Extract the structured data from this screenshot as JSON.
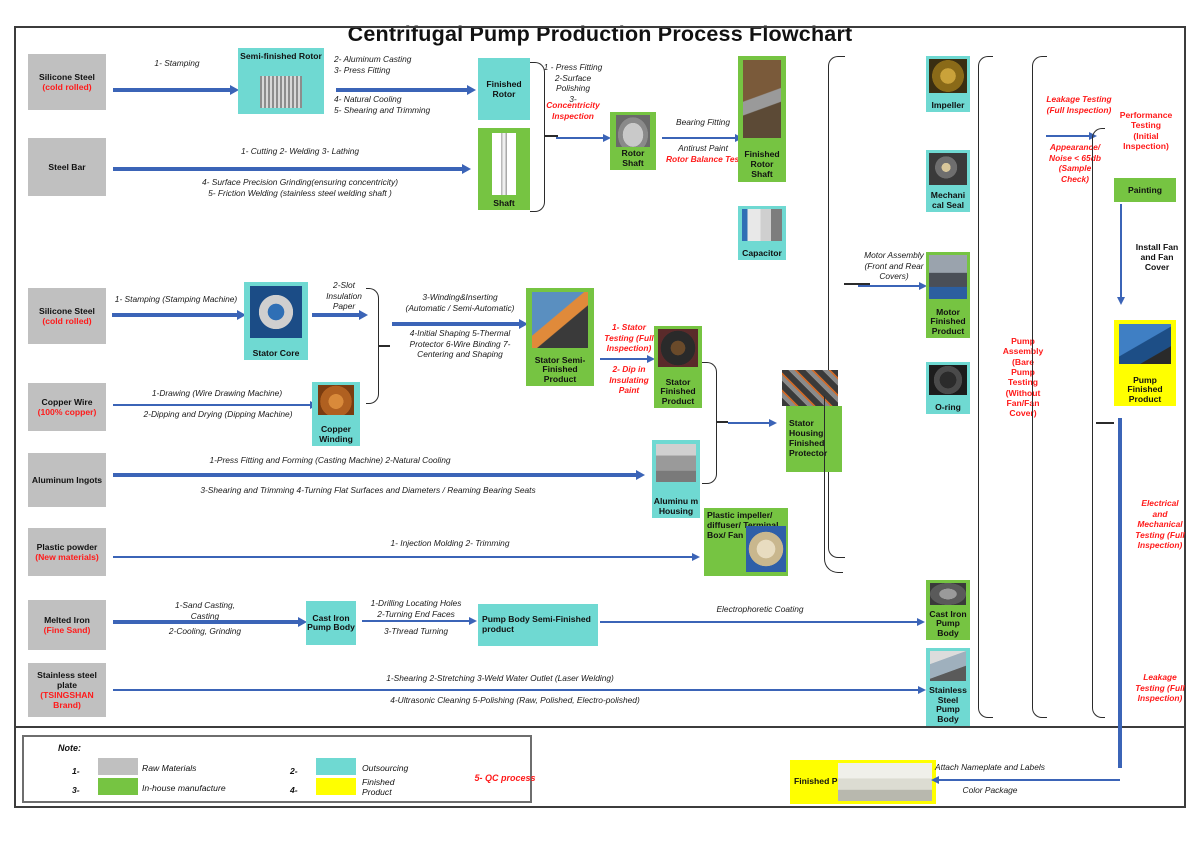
{
  "title": "Centrifugal Pump Production Process Flowchart",
  "raw_materials": [
    {
      "id": "silicone-steel-1",
      "line1": "Silicone Steel",
      "line2": "(cold rolled)"
    },
    {
      "id": "steel-bar",
      "line1": "Steel Bar",
      "line2": ""
    },
    {
      "id": "silicone-steel-2",
      "line1": "Silicone Steel",
      "line2": "(cold rolled)"
    },
    {
      "id": "copper-wire",
      "line1": "Copper Wire",
      "line2": "(100% copper)"
    },
    {
      "id": "aluminum-ingots",
      "line1": "Aluminum Ingots",
      "line2": ""
    },
    {
      "id": "plastic-powder",
      "line1": "Plastic powder",
      "line2": "(New materials)"
    },
    {
      "id": "melted-iron",
      "line1": "Melted Iron",
      "line2": "(Fine Sand)"
    },
    {
      "id": "stainless-steel-plate",
      "line1": "Stainless steel plate",
      "line2": "(TSINGSHAN Brand)"
    }
  ],
  "nodes": {
    "semi_finished_rotor": "Semi-finished Rotor",
    "finished_rotor": "Finished Rotor",
    "shaft": "Shaft",
    "rotor_shaft": "Rotor Shaft",
    "finished_rotor_shaft": "Finished Rotor Shaft",
    "capacitor": "Capacitor",
    "impeller": "Impeller",
    "mechanical_seal": "Mechani cal Seal",
    "motor_finished_product": "Motor Finished Product",
    "o_ring": "O-ring",
    "stator_core": "Stator Core",
    "stator_semi_finished": "Stator Semi-Finished Product",
    "stator_finished": "Stator Finished Product",
    "copper_winding": "Copper Winding",
    "aluminum_housing": "Aluminu m Housing",
    "stator_housing": "Stator Housing Finished Protector",
    "plastic_parts": "Plastic impeller/ diffuser/ Terminal Box/ Fan",
    "cast_iron_pump_body": "Cast Iron Pump Body",
    "pump_body_semi": "Pump Body Semi-Finished product",
    "cast_iron_pump_body_2": "Cast Iron Pump Body",
    "stainless_pump_body": "Stainless Steel Pump Body",
    "painting": "Painting",
    "pump_finished_product": "Pump Finished Product",
    "finished_product": "Finished Product"
  },
  "process_labels": {
    "stamping": "1- Stamping",
    "rotor_top": "2- Aluminum Casting\n3- Press Fitting",
    "rotor_bottom": "4- Natural Cooling\n5- Shearing and Trimming",
    "bar_top": "1- Cutting  2- Welding 3- Lathing",
    "bar_bottom": "4- Surface Precision Grinding(ensuring concentricity)\n5- Friction Welding (stainless steel welding shaft )",
    "press_fitting_black": "1 - Press Fitting\n2-Surface\nPolishing\n3-",
    "concentricity_red": "Concentricity\nInspection",
    "bearing_fitting": "Bearing Fitting",
    "antirust_paint": "Antirust Paint",
    "rotor_balance_test": "Rotor Balance Test",
    "motor_assembly": "Motor Assembly\n(Front and Rear\nCovers)",
    "leakage_testing_full": "Leakage Testing\n(Full Inspection)",
    "appearance_noise": "Appearance/\nNoise < 65db\n(Sample\nCheck)",
    "performance_testing": "Performance\nTesting\n(Initial\nInspection)",
    "install_fan": "Install Fan\nand Fan\nCover",
    "pump_assembly": "Pump\nAssembly\n(Bare\nPump\nTesting\n(Without\nFan/Fan\nCover)",
    "electrical_mechanical": "Electrical\nand\nMechanical\nTesting (Full\nInspection)",
    "leakage_testing_bottom": "Leakage\nTesting (Full\nInspection)",
    "stamping_machine": "1- Stamping (Stamping Machine)",
    "slot_insulation": "2-Slot\nInsulation\nPaper",
    "winding_inserting": "3-Winding&Inserting\n(Automatic / Semi-Automatic)",
    "initial_shaping": "4-Initial Shaping   5-Thermal\nProtector 6-Wire Binding  7-\nCentering and Shaping",
    "stator_testing": "1- Stator\nTesting (Full\nInspection)",
    "dip_insulating": "2- Dip in\nInsulating\nPaint",
    "drawing": "1-Drawing (Wire Drawing Machine)",
    "dipping_drying": "2-Dipping and Drying (Dipping Machine)",
    "press_fitting_forming": "1-Press Fitting and Forming (Casting Machine)    2-Natural Cooling",
    "shearing_trimming": "3-Shearing and Trimming    4-Turning Flat Surfaces and Diameters / Reaming Bearing Seats",
    "injection_molding": "1- Injection Molding 2- Trimming",
    "sand_casting": "1-Sand Casting,\nCasting",
    "cooling_grinding": "2-Cooling, Grinding",
    "drilling": "1-Drilling Locating Holes\n2-Turning End Faces",
    "thread_turning": "3-Thread Turning",
    "electrophoretic": "Electrophoretic Coating",
    "shearing_stretching": "1-Shearing     2-Stretching     3-Weld Water Outlet (Laser Welding)",
    "ultrasonic": "4-Ultrasonic Cleaning                    5-Polishing (Raw, Polished, Electro-polished)",
    "attach_nameplate": "Attach Nameplate and Labels",
    "color_package": "Color Package"
  },
  "legend": {
    "note": "Note:",
    "items": [
      {
        "num": "1-",
        "label": "Raw Materials",
        "color": "#c0c0c0"
      },
      {
        "num": "2-",
        "label": "Outsourcing",
        "color": "#6fd9d2"
      },
      {
        "num": "3-",
        "label": "In-house manufacture",
        "color": "#76c442"
      },
      {
        "num": "4-",
        "label": "Finished Product",
        "color": "#ffff00"
      }
    ],
    "qc": "5-  QC process"
  },
  "colors": {
    "raw": "#c0c0c0",
    "outsourcing": "#6fd9d2",
    "inhouse": "#76c442",
    "finished": "#ffff00",
    "arrow": "#3b64b7",
    "red": "#ff1a1a"
  }
}
